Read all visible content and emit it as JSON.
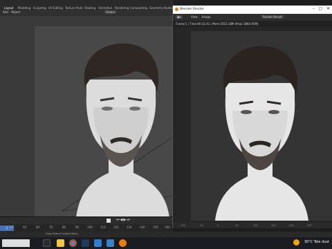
{
  "app": {
    "workspaces": [
      "Layout",
      "Modeling",
      "Sculpting",
      "UV Editing",
      "Texture Paint",
      "Shading",
      "Animation",
      "Rendering",
      "Compositing",
      "Geometry Nodes"
    ],
    "active_workspace": "Layout"
  },
  "viewport_header": {
    "menu_add": "Add",
    "menu_object": "Object",
    "transform": "Global"
  },
  "render_window": {
    "title": "Blender Render",
    "menu": [
      "View",
      "Image"
    ],
    "slot": "Render Result",
    "info": "Frame:1 | Time:00:32.43 | Mem:3553.18M (Peak 3864.95M)",
    "ruler": [
      "-100",
      "-50",
      "0",
      "50",
      "100",
      "150",
      "200",
      "250",
      "300"
    ]
  },
  "timeline": {
    "current_frame": "1",
    "ticks": [
      "40",
      "50",
      "60",
      "70",
      "80",
      "90",
      "100",
      "110",
      "120",
      "130",
      "140",
      "150",
      "160",
      "170"
    ]
  },
  "statusbar": {
    "left": "Drag Object Context Menu"
  },
  "taskbar": {
    "icons": [
      "windows-icon",
      "search-icon",
      "taskview-icon",
      "explorer-icon",
      "chrome-icon",
      "photoshop-icon",
      "mail-icon",
      "store-icon",
      "vlc-icon",
      "blender-icon"
    ],
    "weather": "30°C  Tele dust",
    "colors": {
      "accent": "#4772b3",
      "taskbar": "#1b1c22"
    }
  }
}
